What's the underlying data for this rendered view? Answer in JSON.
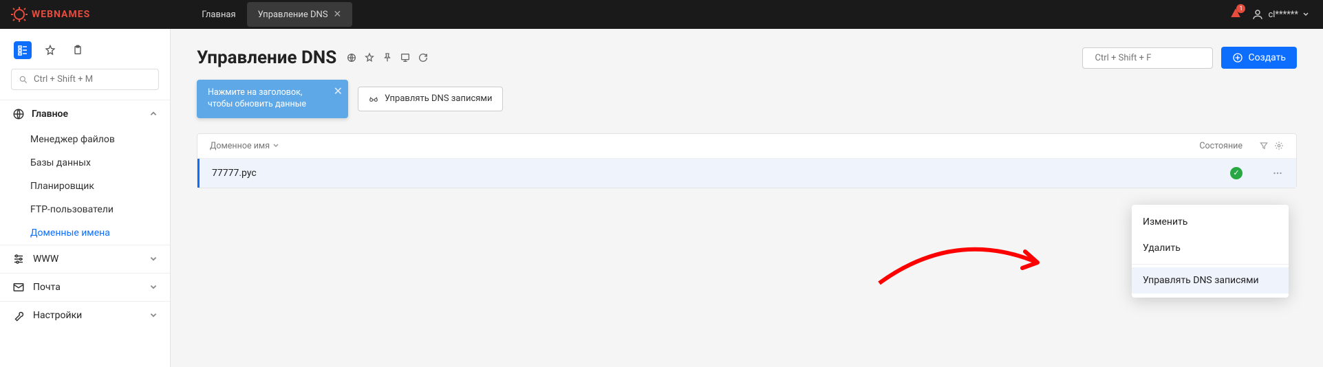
{
  "brand": "WEBNAMES",
  "topbar": {
    "tabs": [
      {
        "label": "Главная"
      },
      {
        "label": "Управление DNS"
      }
    ],
    "notification_count": "1",
    "user_label": "cl******"
  },
  "sidebar": {
    "search_placeholder": "Ctrl + Shift + M",
    "main_section": {
      "label": "Главное",
      "items": [
        {
          "label": "Менеджер файлов"
        },
        {
          "label": "Базы данных"
        },
        {
          "label": "Планировщик"
        },
        {
          "label": "FTP-пользователи"
        },
        {
          "label": "Доменные имена"
        }
      ]
    },
    "collapsed": [
      {
        "label": "WWW"
      },
      {
        "label": "Почта"
      },
      {
        "label": "Настройки"
      }
    ]
  },
  "main": {
    "title": "Управление DNS",
    "search_placeholder": "Ctrl + Shift + F",
    "create_label": "Создать",
    "hint": "Нажмите на заголовок, чтобы обновить данные",
    "filter_pill": "Управлять DNS записями",
    "table": {
      "col_name": "Доменное имя",
      "col_status": "Состояние",
      "rows": [
        {
          "name": "77777.рус",
          "status": "ok"
        }
      ]
    }
  },
  "context_menu": {
    "edit": "Изменить",
    "delete": "Удалить",
    "manage": "Управлять DNS записями"
  }
}
